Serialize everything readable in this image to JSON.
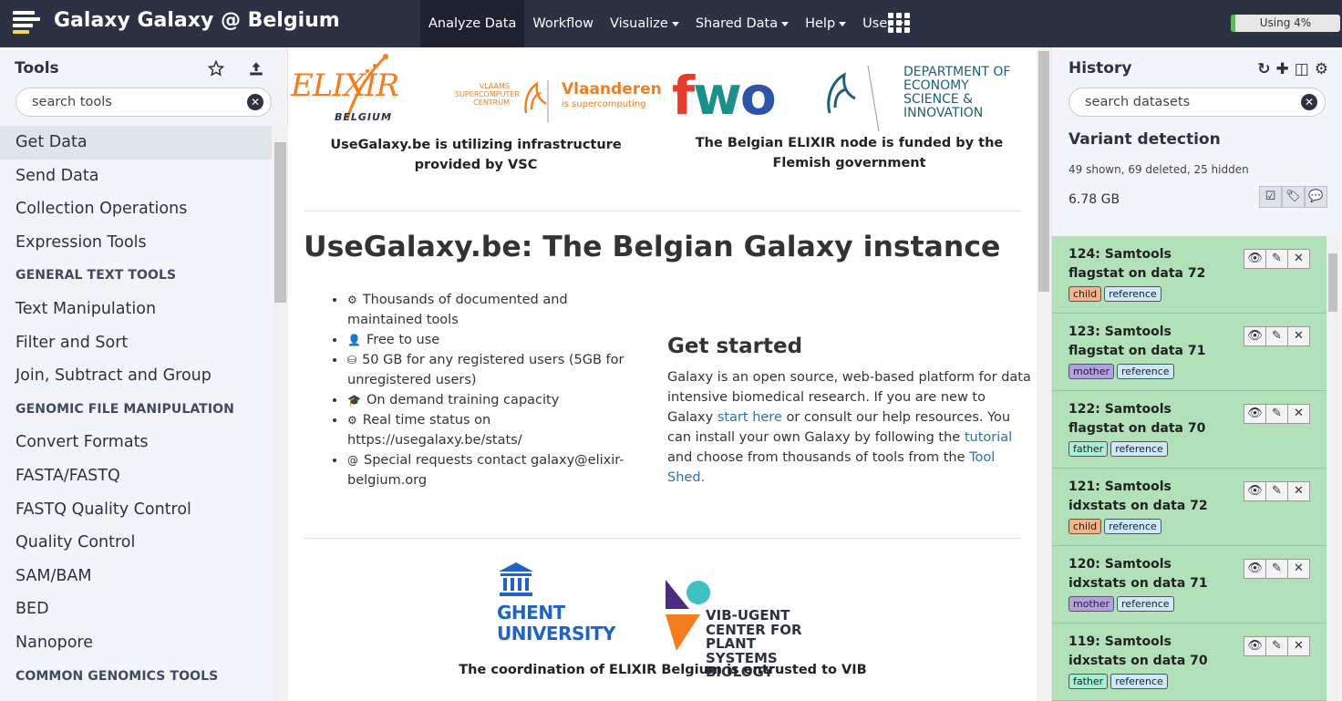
{
  "masthead": {
    "brand": "Galaxy Galaxy @ Belgium",
    "nav": [
      {
        "label": "Analyze Data",
        "active": true,
        "dropdown": false
      },
      {
        "label": "Workflow",
        "active": false,
        "dropdown": false
      },
      {
        "label": "Visualize",
        "active": false,
        "dropdown": true
      },
      {
        "label": "Shared Data",
        "active": false,
        "dropdown": true
      },
      {
        "label": "Help",
        "active": false,
        "dropdown": true
      },
      {
        "label": "User",
        "active": false,
        "dropdown": true
      }
    ],
    "apps_icon": "grid-icon",
    "quota": {
      "label": "Using 4%",
      "percent": 4
    }
  },
  "tool_panel": {
    "title": "Tools",
    "search_placeholder": "search tools",
    "icons": [
      "star-icon",
      "upload-icon"
    ],
    "items": [
      {
        "label": "Get Data",
        "type": "section",
        "selected": true
      },
      {
        "label": "Send Data",
        "type": "section"
      },
      {
        "label": "Collection Operations",
        "type": "section"
      },
      {
        "label": "Expression Tools",
        "type": "section"
      },
      {
        "label": "GENERAL TEXT TOOLS",
        "type": "header"
      },
      {
        "label": "Text Manipulation",
        "type": "section"
      },
      {
        "label": "Filter and Sort",
        "type": "section"
      },
      {
        "label": "Join, Subtract and Group",
        "type": "section"
      },
      {
        "label": "GENOMIC FILE MANIPULATION",
        "type": "header"
      },
      {
        "label": "Convert Formats",
        "type": "section"
      },
      {
        "label": "FASTA/FASTQ",
        "type": "section"
      },
      {
        "label": "FASTQ Quality Control",
        "type": "section"
      },
      {
        "label": "Quality Control",
        "type": "section"
      },
      {
        "label": "SAM/BAM",
        "type": "section"
      },
      {
        "label": "BED",
        "type": "section"
      },
      {
        "label": "Nanopore",
        "type": "section"
      },
      {
        "label": "COMMON GENOMICS TOOLS",
        "type": "header"
      }
    ]
  },
  "center": {
    "logos": {
      "elixir": {
        "name": "ELIXIR",
        "sub": "BELGIUM"
      },
      "vsc": {
        "left1": "VLAAMS",
        "left2": "SUPERCOMPUTER",
        "left3": "CENTRUM",
        "name": "Vlaanderen",
        "sub": "is supercomputing"
      },
      "fwo": {
        "name": "fwo"
      },
      "ewi": {
        "line1": "DEPARTMENT OF",
        "line2": "ECONOMY",
        "line3": "SCIENCE &",
        "line4": "INNOVATION"
      },
      "ugent": {
        "line1": "GHENT",
        "line2": "UNIVERSITY"
      },
      "vib": {
        "line1": "VIB-UGENT",
        "line2": "CENTER FOR PLANT",
        "line3": "SYSTEMS BIOLOGY"
      }
    },
    "caption_vsc": "UseGalaxy.be is utilizing infrastructure provided by VSC",
    "caption_fwo": "The Belgian ELIXIR node is funded by the Flemish government",
    "title": "UseGalaxy.be: The Belgian Galaxy instance",
    "features": [
      {
        "icon": "cogs-icon",
        "glyph": "⚙",
        "text": "Thousands of documented and maintained tools"
      },
      {
        "icon": "user-plus-icon",
        "glyph": "👤",
        "text": "Free to use"
      },
      {
        "icon": "hdd-icon",
        "glyph": "⛁",
        "text": "50 GB for any registered users (5GB for unregistered users)"
      },
      {
        "icon": "graduation-cap-icon",
        "glyph": "🎓",
        "text": "On demand training capacity"
      },
      {
        "icon": "cogs-icon",
        "glyph": "⚙",
        "text": "Real time status on https://usegalaxy.be/stats/"
      },
      {
        "icon": "at-icon",
        "glyph": "@",
        "text": "Special requests contact galaxy@elixir-belgium.org"
      }
    ],
    "get_started": {
      "heading": "Get started",
      "p1": "Galaxy is an open source, web-based platform for data intensive biomedical research. If you are new to Galaxy ",
      "link1": "start here",
      "p2": " or consult our help resources. You can install your own Galaxy by following the ",
      "link2": "tutorial",
      "p3": " and choose from thousands of tools from the ",
      "link3": "Tool Shed."
    },
    "caption_vib": "The coordination of ELIXIR Belgium is entrusted to VIB"
  },
  "history": {
    "title": "History",
    "icons": [
      "refresh-icon",
      "plus-icon",
      "columns-icon",
      "gear-icon"
    ],
    "search_placeholder": "search datasets",
    "name": "Variant detection",
    "stats": "49 shown, 69 deleted, 25 hidden",
    "size": "6.78 GB",
    "datasets": [
      {
        "title": "124: Samtools flagstat on data 72",
        "tags": [
          {
            "label": "child",
            "kind": "child"
          },
          {
            "label": "reference",
            "kind": "ref"
          }
        ]
      },
      {
        "title": "123: Samtools flagstat on data 71",
        "tags": [
          {
            "label": "mother",
            "kind": "mother"
          },
          {
            "label": "reference",
            "kind": "ref"
          }
        ]
      },
      {
        "title": "122: Samtools flagstat on data 70",
        "tags": [
          {
            "label": "father",
            "kind": "father"
          },
          {
            "label": "reference",
            "kind": "ref"
          }
        ]
      },
      {
        "title": "121: Samtools idxstats on data 72",
        "tags": [
          {
            "label": "child",
            "kind": "child"
          },
          {
            "label": "reference",
            "kind": "ref"
          }
        ]
      },
      {
        "title": "120: Samtools idxstats on data 71",
        "tags": [
          {
            "label": "mother",
            "kind": "mother"
          },
          {
            "label": "reference",
            "kind": "ref"
          }
        ]
      },
      {
        "title": "119: Samtools idxstats on data 70",
        "tags": [
          {
            "label": "father",
            "kind": "father"
          },
          {
            "label": "reference",
            "kind": "ref"
          }
        ]
      }
    ]
  },
  "colors": {
    "masthead": "#2c3143",
    "ok_dataset": "#b1e0b9",
    "link": "#2a6fb6"
  }
}
